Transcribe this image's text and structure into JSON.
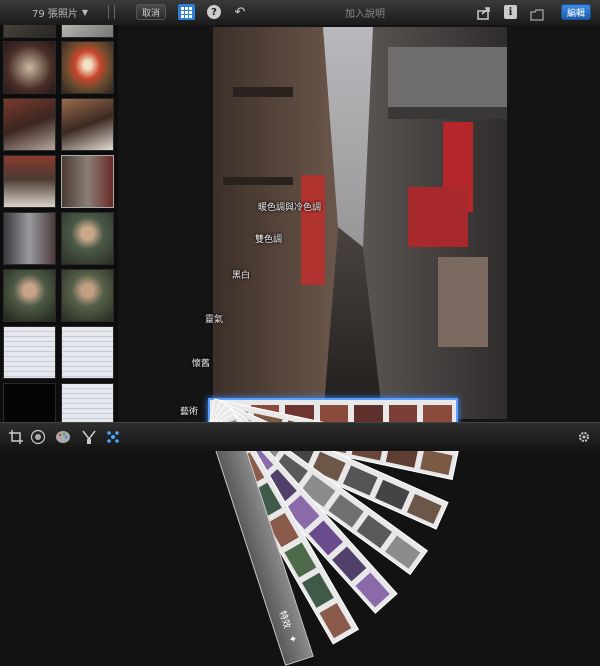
{
  "topbar": {
    "album_label": "79 張照片",
    "cancel_label": "取消",
    "title": "加入說明",
    "edit_label": "編輯",
    "icons": [
      "grid-icon",
      "help-icon",
      "undo-icon",
      "share-icon",
      "info-icon",
      "folder-icon"
    ]
  },
  "fan": {
    "top_label": "特效",
    "labels": [
      "暖色調與冷色調",
      "雙色調",
      "黑白",
      "靈氣",
      "懷舊",
      "藝術"
    ],
    "selected": "藝術"
  },
  "bottombar": {
    "icons": [
      "crop-icon",
      "color-icon",
      "palette-icon",
      "brush-icon",
      "effects-icon",
      "gear-icon"
    ],
    "active": "effects-icon"
  },
  "colors": {
    "accent": "#2f7fd6",
    "effects_active": "#4aa8ff"
  }
}
